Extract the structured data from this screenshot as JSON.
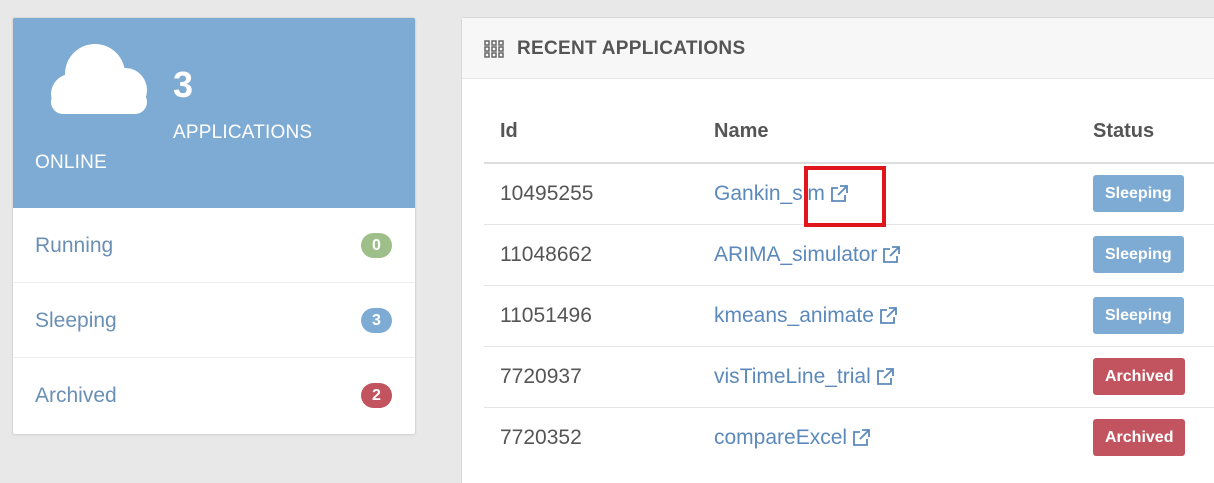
{
  "summary": {
    "count": "3",
    "apps_label": "APPLICATIONS",
    "online_label": "ONLINE",
    "statuses": [
      {
        "label": "Running",
        "count": "0",
        "color": "#9fbf8a"
      },
      {
        "label": "Sleeping",
        "count": "3",
        "color": "#7eabd4"
      },
      {
        "label": "Archived",
        "count": "2",
        "color": "#c1545f"
      }
    ]
  },
  "recent": {
    "title": "RECENT APPLICATIONS",
    "columns": {
      "id": "Id",
      "name": "Name",
      "status": "Status"
    },
    "rows": [
      {
        "id": "10495255",
        "name": "Gankin_sim",
        "status": "Sleeping"
      },
      {
        "id": "11048662",
        "name": "ARIMA_simulator",
        "status": "Sleeping"
      },
      {
        "id": "11051496",
        "name": "kmeans_animate",
        "status": "Sleeping"
      },
      {
        "id": "7720937",
        "name": "visTimeLine_trial",
        "status": "Archived"
      },
      {
        "id": "7720352",
        "name": "compareExcel",
        "status": "Archived"
      }
    ]
  },
  "colors": {
    "sleeping": "#7eabd4",
    "archived": "#c1545f",
    "header_blue": "#7eabd4",
    "link": "#5c89bb",
    "highlight": "#e1151c"
  },
  "icons": [
    "cloud-icon",
    "grid-icon",
    "external-link-icon"
  ]
}
